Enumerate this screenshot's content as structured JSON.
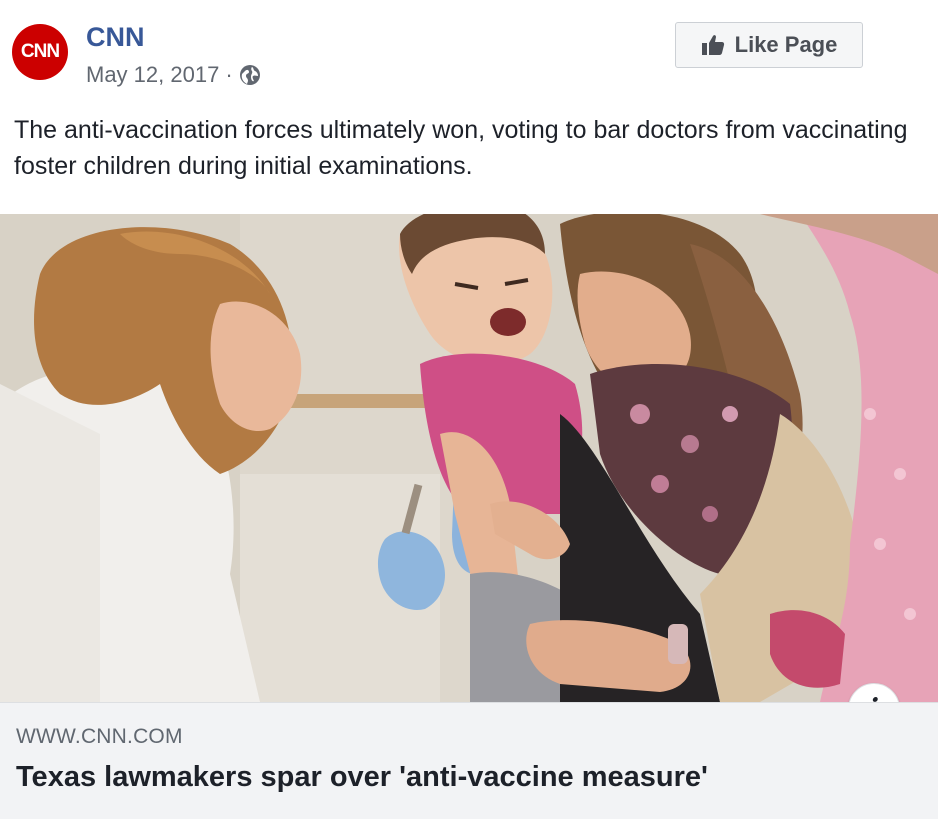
{
  "post": {
    "avatar_text": "CNN",
    "page_name": "CNN",
    "date": "May 12, 2017",
    "separator": "·",
    "audience_icon": "globe-icon",
    "like_button_label": "Like Page",
    "like_icon": "thumbs-up-icon",
    "caption": "The anti-vaccination forces ultimately won, voting to bar doctors from vaccinating foster children during initial examinations."
  },
  "link": {
    "domain": "WWW.CNN.COM",
    "headline": "Texas lawmakers spar over 'anti-vaccine measure'",
    "info_icon": "i"
  },
  "colors": {
    "brand_red": "#cc0000",
    "page_name_blue": "#385898",
    "meta_gray": "#616770",
    "link_bg": "#f2f3f5"
  }
}
